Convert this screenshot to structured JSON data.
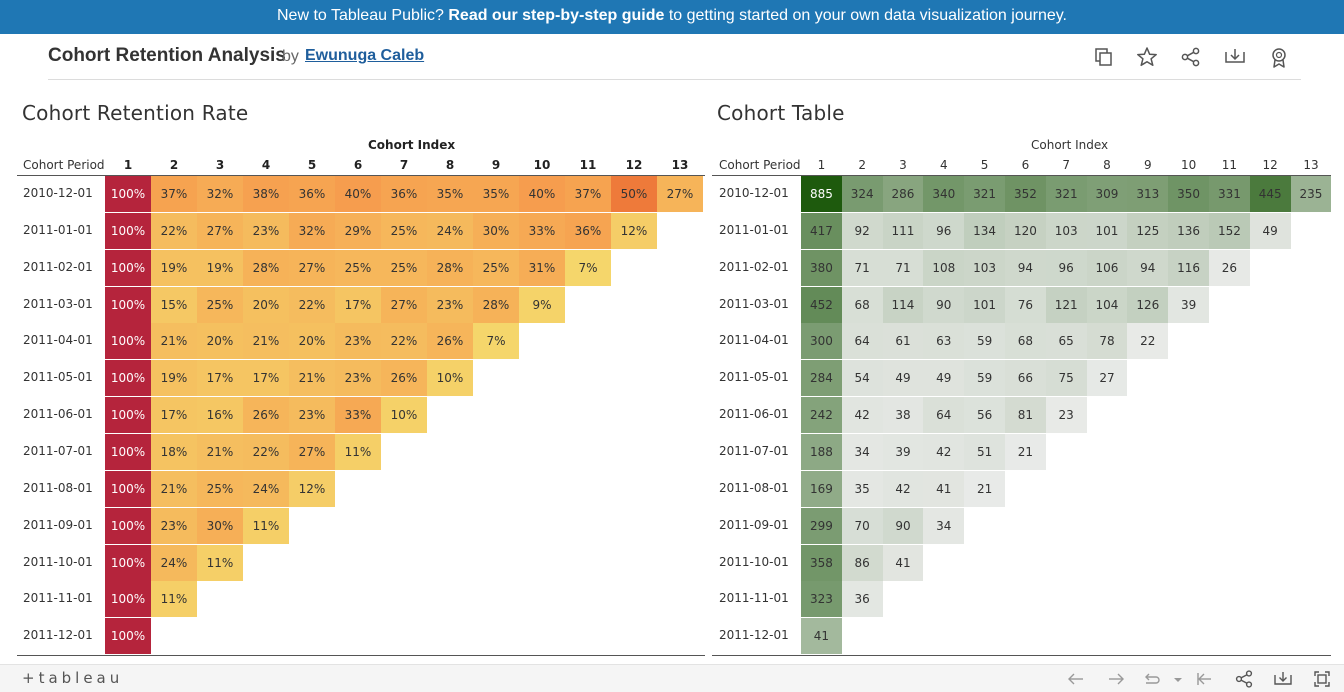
{
  "banner": {
    "prefix": "New to Tableau Public? ",
    "link": "Read our step-by-step guide",
    "suffix": " to getting started on your own data visualization journey."
  },
  "header": {
    "title": "Cohort Retention Analysis",
    "by": "by",
    "author": "Ewunuga Caleb",
    "icons": [
      "copy-icon",
      "star-icon",
      "share-icon",
      "download-icon",
      "award-icon"
    ]
  },
  "retention": {
    "title": "Cohort Retention Rate",
    "axis_title": "Cohort Index",
    "row_header": "Cohort Period",
    "columns": [
      "1",
      "2",
      "3",
      "4",
      "5",
      "6",
      "7",
      "8",
      "9",
      "10",
      "11",
      "12",
      "13"
    ],
    "rows": [
      {
        "period": "2010-12-01",
        "values": [
          "100%",
          "37%",
          "32%",
          "38%",
          "36%",
          "40%",
          "36%",
          "35%",
          "35%",
          "40%",
          "37%",
          "50%",
          "27%"
        ]
      },
      {
        "period": "2011-01-01",
        "values": [
          "100%",
          "22%",
          "27%",
          "23%",
          "32%",
          "29%",
          "25%",
          "24%",
          "30%",
          "33%",
          "36%",
          "12%"
        ]
      },
      {
        "period": "2011-02-01",
        "values": [
          "100%",
          "19%",
          "19%",
          "28%",
          "27%",
          "25%",
          "25%",
          "28%",
          "25%",
          "31%",
          "7%"
        ]
      },
      {
        "period": "2011-03-01",
        "values": [
          "100%",
          "15%",
          "25%",
          "20%",
          "22%",
          "17%",
          "27%",
          "23%",
          "28%",
          "9%"
        ]
      },
      {
        "period": "2011-04-01",
        "values": [
          "100%",
          "21%",
          "20%",
          "21%",
          "20%",
          "23%",
          "22%",
          "26%",
          "7%"
        ]
      },
      {
        "period": "2011-05-01",
        "values": [
          "100%",
          "19%",
          "17%",
          "17%",
          "21%",
          "23%",
          "26%",
          "10%"
        ]
      },
      {
        "period": "2011-06-01",
        "values": [
          "100%",
          "17%",
          "16%",
          "26%",
          "23%",
          "33%",
          "10%"
        ]
      },
      {
        "period": "2011-07-01",
        "values": [
          "100%",
          "18%",
          "21%",
          "22%",
          "27%",
          "11%"
        ]
      },
      {
        "period": "2011-08-01",
        "values": [
          "100%",
          "21%",
          "25%",
          "24%",
          "12%"
        ]
      },
      {
        "period": "2011-09-01",
        "values": [
          "100%",
          "23%",
          "30%",
          "11%"
        ]
      },
      {
        "period": "2011-10-01",
        "values": [
          "100%",
          "24%",
          "11%"
        ]
      },
      {
        "period": "2011-11-01",
        "values": [
          "100%",
          "11%"
        ]
      },
      {
        "period": "2011-12-01",
        "values": [
          "100%"
        ]
      }
    ]
  },
  "counts": {
    "title": "Cohort Table",
    "axis_title": "Cohort Index",
    "row_header": "Cohort Period",
    "columns": [
      "1",
      "2",
      "3",
      "4",
      "5",
      "6",
      "7",
      "8",
      "9",
      "10",
      "11",
      "12",
      "13"
    ],
    "rows": [
      {
        "period": "2010-12-01",
        "values": [
          "885",
          "324",
          "286",
          "340",
          "321",
          "352",
          "321",
          "309",
          "313",
          "350",
          "331",
          "445",
          "235"
        ]
      },
      {
        "period": "2011-01-01",
        "values": [
          "417",
          "92",
          "111",
          "96",
          "134",
          "120",
          "103",
          "101",
          "125",
          "136",
          "152",
          "49"
        ]
      },
      {
        "period": "2011-02-01",
        "values": [
          "380",
          "71",
          "71",
          "108",
          "103",
          "94",
          "96",
          "106",
          "94",
          "116",
          "26"
        ]
      },
      {
        "period": "2011-03-01",
        "values": [
          "452",
          "68",
          "114",
          "90",
          "101",
          "76",
          "121",
          "104",
          "126",
          "39"
        ]
      },
      {
        "period": "2011-04-01",
        "values": [
          "300",
          "64",
          "61",
          "63",
          "59",
          "68",
          "65",
          "78",
          "22"
        ]
      },
      {
        "period": "2011-05-01",
        "values": [
          "284",
          "54",
          "49",
          "49",
          "59",
          "66",
          "75",
          "27"
        ]
      },
      {
        "period": "2011-06-01",
        "values": [
          "242",
          "42",
          "38",
          "64",
          "56",
          "81",
          "23"
        ]
      },
      {
        "period": "2011-07-01",
        "values": [
          "188",
          "34",
          "39",
          "42",
          "51",
          "21"
        ]
      },
      {
        "period": "2011-08-01",
        "values": [
          "169",
          "35",
          "42",
          "41",
          "21"
        ]
      },
      {
        "period": "2011-09-01",
        "values": [
          "299",
          "70",
          "90",
          "34"
        ]
      },
      {
        "period": "2011-10-01",
        "values": [
          "358",
          "86",
          "41"
        ]
      },
      {
        "period": "2011-11-01",
        "values": [
          "323",
          "36"
        ]
      },
      {
        "period": "2011-12-01",
        "values": [
          "41"
        ]
      }
    ]
  },
  "colors": {
    "banner_bg": "#1f77b4",
    "author_link": "#1f5e9c",
    "heat_low": "#f5d66b",
    "heat_mid": "#f69a4c",
    "heat_high": "#b5243c",
    "green_low": "#efefef",
    "green_high": "#1e5a0d"
  },
  "footer": {
    "logo": "+tableau",
    "icons": [
      "back-icon",
      "forward-icon",
      "revert-icon",
      "revert-menu-icon",
      "first-icon",
      "share-icon",
      "download-icon",
      "fullscreen-icon"
    ]
  }
}
